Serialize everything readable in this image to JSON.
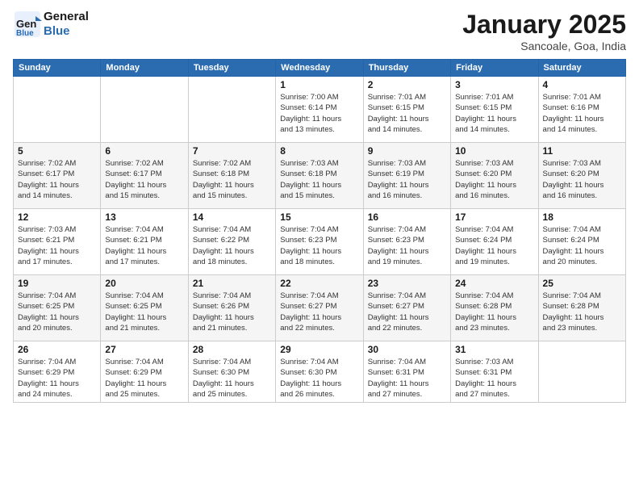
{
  "header": {
    "logo_line1": "General",
    "logo_line2": "Blue",
    "month_title": "January 2025",
    "subtitle": "Sancoale, Goa, India"
  },
  "weekdays": [
    "Sunday",
    "Monday",
    "Tuesday",
    "Wednesday",
    "Thursday",
    "Friday",
    "Saturday"
  ],
  "weeks": [
    [
      {
        "day": "",
        "info": ""
      },
      {
        "day": "",
        "info": ""
      },
      {
        "day": "",
        "info": ""
      },
      {
        "day": "1",
        "info": "Sunrise: 7:00 AM\nSunset: 6:14 PM\nDaylight: 11 hours\nand 13 minutes."
      },
      {
        "day": "2",
        "info": "Sunrise: 7:01 AM\nSunset: 6:15 PM\nDaylight: 11 hours\nand 14 minutes."
      },
      {
        "day": "3",
        "info": "Sunrise: 7:01 AM\nSunset: 6:15 PM\nDaylight: 11 hours\nand 14 minutes."
      },
      {
        "day": "4",
        "info": "Sunrise: 7:01 AM\nSunset: 6:16 PM\nDaylight: 11 hours\nand 14 minutes."
      }
    ],
    [
      {
        "day": "5",
        "info": "Sunrise: 7:02 AM\nSunset: 6:17 PM\nDaylight: 11 hours\nand 14 minutes."
      },
      {
        "day": "6",
        "info": "Sunrise: 7:02 AM\nSunset: 6:17 PM\nDaylight: 11 hours\nand 15 minutes."
      },
      {
        "day": "7",
        "info": "Sunrise: 7:02 AM\nSunset: 6:18 PM\nDaylight: 11 hours\nand 15 minutes."
      },
      {
        "day": "8",
        "info": "Sunrise: 7:03 AM\nSunset: 6:18 PM\nDaylight: 11 hours\nand 15 minutes."
      },
      {
        "day": "9",
        "info": "Sunrise: 7:03 AM\nSunset: 6:19 PM\nDaylight: 11 hours\nand 16 minutes."
      },
      {
        "day": "10",
        "info": "Sunrise: 7:03 AM\nSunset: 6:20 PM\nDaylight: 11 hours\nand 16 minutes."
      },
      {
        "day": "11",
        "info": "Sunrise: 7:03 AM\nSunset: 6:20 PM\nDaylight: 11 hours\nand 16 minutes."
      }
    ],
    [
      {
        "day": "12",
        "info": "Sunrise: 7:03 AM\nSunset: 6:21 PM\nDaylight: 11 hours\nand 17 minutes."
      },
      {
        "day": "13",
        "info": "Sunrise: 7:04 AM\nSunset: 6:21 PM\nDaylight: 11 hours\nand 17 minutes."
      },
      {
        "day": "14",
        "info": "Sunrise: 7:04 AM\nSunset: 6:22 PM\nDaylight: 11 hours\nand 18 minutes."
      },
      {
        "day": "15",
        "info": "Sunrise: 7:04 AM\nSunset: 6:23 PM\nDaylight: 11 hours\nand 18 minutes."
      },
      {
        "day": "16",
        "info": "Sunrise: 7:04 AM\nSunset: 6:23 PM\nDaylight: 11 hours\nand 19 minutes."
      },
      {
        "day": "17",
        "info": "Sunrise: 7:04 AM\nSunset: 6:24 PM\nDaylight: 11 hours\nand 19 minutes."
      },
      {
        "day": "18",
        "info": "Sunrise: 7:04 AM\nSunset: 6:24 PM\nDaylight: 11 hours\nand 20 minutes."
      }
    ],
    [
      {
        "day": "19",
        "info": "Sunrise: 7:04 AM\nSunset: 6:25 PM\nDaylight: 11 hours\nand 20 minutes."
      },
      {
        "day": "20",
        "info": "Sunrise: 7:04 AM\nSunset: 6:25 PM\nDaylight: 11 hours\nand 21 minutes."
      },
      {
        "day": "21",
        "info": "Sunrise: 7:04 AM\nSunset: 6:26 PM\nDaylight: 11 hours\nand 21 minutes."
      },
      {
        "day": "22",
        "info": "Sunrise: 7:04 AM\nSunset: 6:27 PM\nDaylight: 11 hours\nand 22 minutes."
      },
      {
        "day": "23",
        "info": "Sunrise: 7:04 AM\nSunset: 6:27 PM\nDaylight: 11 hours\nand 22 minutes."
      },
      {
        "day": "24",
        "info": "Sunrise: 7:04 AM\nSunset: 6:28 PM\nDaylight: 11 hours\nand 23 minutes."
      },
      {
        "day": "25",
        "info": "Sunrise: 7:04 AM\nSunset: 6:28 PM\nDaylight: 11 hours\nand 23 minutes."
      }
    ],
    [
      {
        "day": "26",
        "info": "Sunrise: 7:04 AM\nSunset: 6:29 PM\nDaylight: 11 hours\nand 24 minutes."
      },
      {
        "day": "27",
        "info": "Sunrise: 7:04 AM\nSunset: 6:29 PM\nDaylight: 11 hours\nand 25 minutes."
      },
      {
        "day": "28",
        "info": "Sunrise: 7:04 AM\nSunset: 6:30 PM\nDaylight: 11 hours\nand 25 minutes."
      },
      {
        "day": "29",
        "info": "Sunrise: 7:04 AM\nSunset: 6:30 PM\nDaylight: 11 hours\nand 26 minutes."
      },
      {
        "day": "30",
        "info": "Sunrise: 7:04 AM\nSunset: 6:31 PM\nDaylight: 11 hours\nand 27 minutes."
      },
      {
        "day": "31",
        "info": "Sunrise: 7:03 AM\nSunset: 6:31 PM\nDaylight: 11 hours\nand 27 minutes."
      },
      {
        "day": "",
        "info": ""
      }
    ]
  ]
}
